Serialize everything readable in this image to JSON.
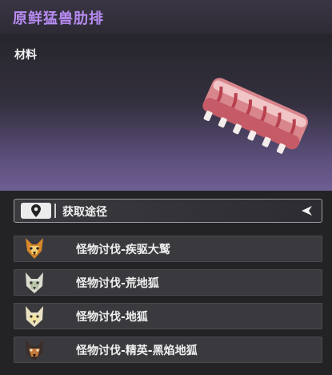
{
  "item": {
    "name": "原鲜猛兽肋排",
    "category": "材料",
    "image_icon": "raw-ribs-icon"
  },
  "source": {
    "label": "获取途径",
    "location_icon": "map-pin-icon",
    "collapse_icon": "collapse-arrow-icon"
  },
  "sources": [
    {
      "label": "怪物讨伐-疾驱大鹫",
      "icon": "vulture-portrait-icon"
    },
    {
      "label": "怪物讨伐-荒地狐",
      "icon": "wasteland-fox-portrait-icon"
    },
    {
      "label": "怪物讨伐-地狐",
      "icon": "earth-fox-portrait-icon"
    },
    {
      "label": "怪物讨伐-精英-黑焰地狐",
      "icon": "black-flame-fox-portrait-icon"
    }
  ],
  "colors": {
    "title": "#b78cf2",
    "header_gradient_bottom": "#6e5e92",
    "list_item_bg": "#3a3a3e"
  }
}
